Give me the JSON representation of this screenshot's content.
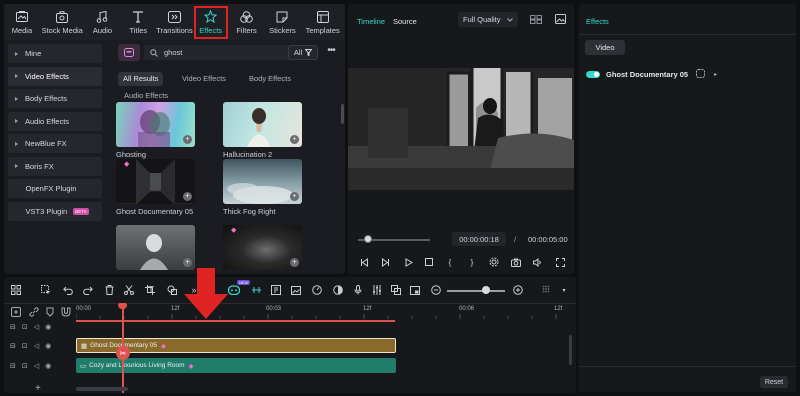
{
  "top_toolbar": {
    "items": [
      {
        "label": "Media",
        "icon": "media-icon"
      },
      {
        "label": "Stock Media",
        "icon": "stock-media-icon"
      },
      {
        "label": "Audio",
        "icon": "audio-icon"
      },
      {
        "label": "Titles",
        "icon": "titles-icon"
      },
      {
        "label": "Transitions",
        "icon": "transitions-icon"
      },
      {
        "label": "Effects",
        "icon": "effects-icon",
        "active": true
      },
      {
        "label": "Filters",
        "icon": "filters-icon"
      },
      {
        "label": "Stickers",
        "icon": "stickers-icon"
      },
      {
        "label": "Templates",
        "icon": "templates-icon"
      }
    ]
  },
  "categories": [
    {
      "label": "Mine",
      "caret": true
    },
    {
      "label": "Video Effects",
      "caret": true,
      "selected": true
    },
    {
      "label": "Body Effects",
      "caret": true
    },
    {
      "label": "Audio Effects",
      "caret": true
    },
    {
      "label": "NewBlue FX",
      "caret": true
    },
    {
      "label": "Boris FX",
      "caret": true
    },
    {
      "label": "OpenFX Plugin",
      "caret": false
    },
    {
      "label": "VST3 Plugin",
      "caret": false,
      "badge": "BETA"
    }
  ],
  "search": {
    "value": "ghost",
    "filter_label": "All"
  },
  "filter_tabs": [
    "All Results",
    "Video Effects",
    "Body Effects",
    "Audio Effects"
  ],
  "results": [
    {
      "name": "Ghosting",
      "premium": false
    },
    {
      "name": "Hallucination 2",
      "premium": false
    },
    {
      "name": "Ghost Documentary 05",
      "premium": true
    },
    {
      "name": "Thick Fog Right",
      "premium": false
    },
    {
      "name": "",
      "premium": false
    },
    {
      "name": "",
      "premium": true
    }
  ],
  "preview": {
    "tab_timeline": "Timeline",
    "tab_source": "Source",
    "quality": "Full Quality",
    "current_time": "00:00:00:18",
    "separator": "/",
    "total_time": "00:00:05:00",
    "progress": 0.14
  },
  "properties": {
    "title": "Effects",
    "tab": "Video",
    "effect_name": "Ghost Documentary 05",
    "effect_enabled": true,
    "reset_label": "Reset"
  },
  "timeline": {
    "ruler_labels": [
      "00:00",
      "12f",
      "00:03",
      "12f",
      "00:06",
      "12f"
    ],
    "clips": {
      "effect": "Ghost Documentary 05",
      "video": "Cozy and Luxurious Living Room"
    },
    "new_badge": "NEW"
  },
  "colors": {
    "accent": "#35d8c8",
    "highlight_red": "#e02424",
    "effect_clip": "#8a6a2b",
    "video_clip": "#1f7d6a",
    "playhead": "#e05252",
    "premium_gem": "#f36bc4"
  }
}
